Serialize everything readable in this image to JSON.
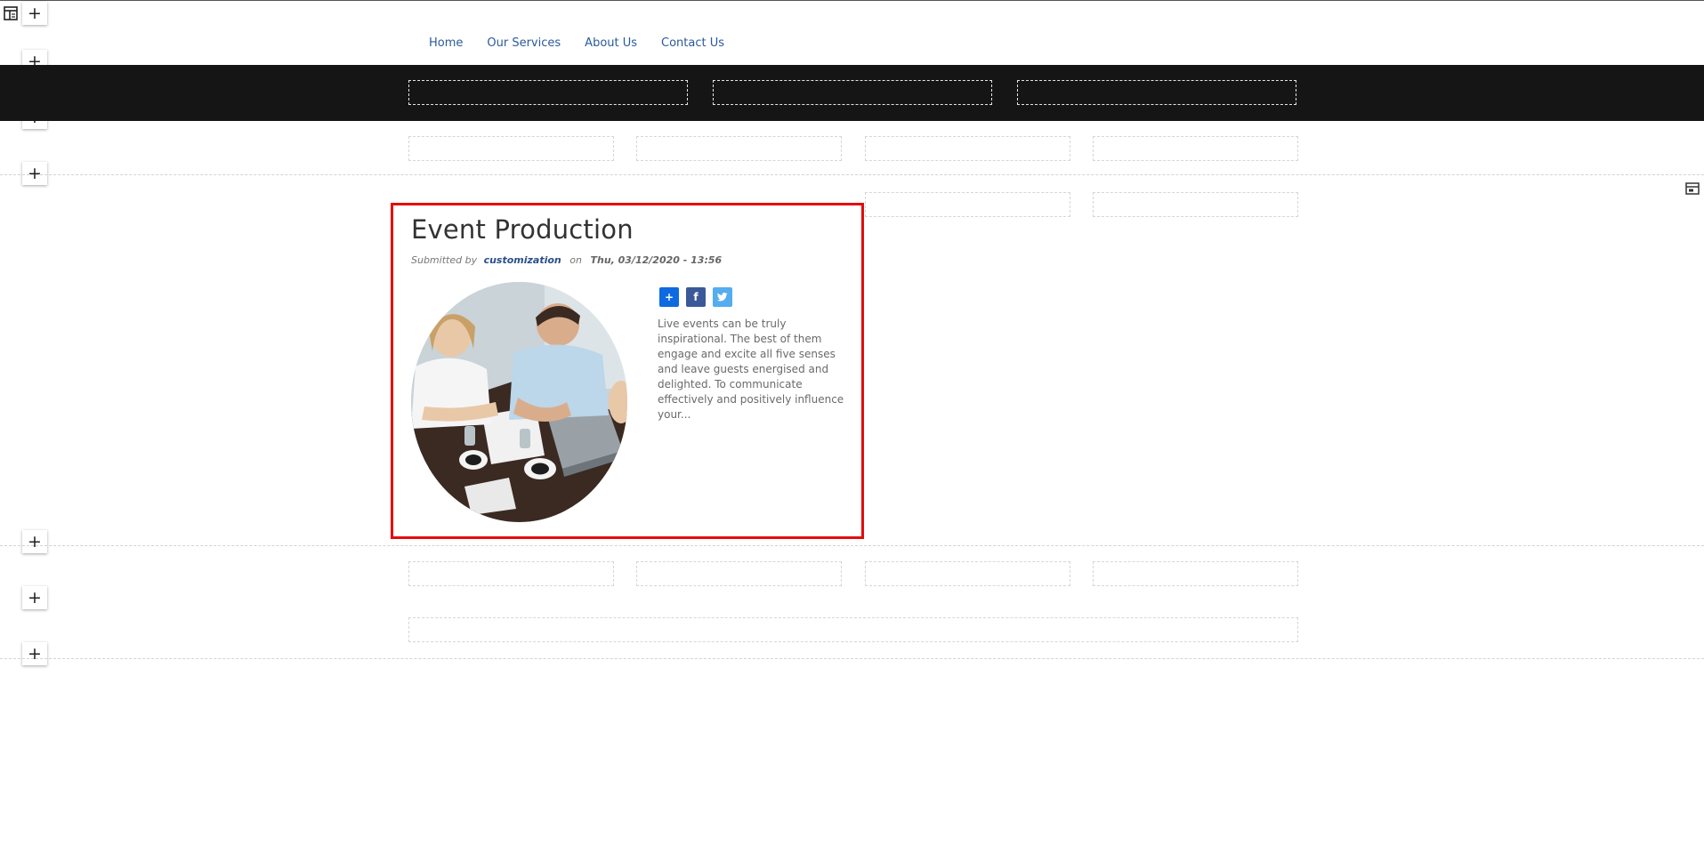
{
  "builder": {
    "add_label": "+",
    "layout_icon": "layout-template-icon",
    "settings_icon": "block-settings-icon"
  },
  "nav": {
    "items": [
      {
        "label": "Home"
      },
      {
        "label": "Our Services"
      },
      {
        "label": "About Us"
      },
      {
        "label": "Contact Us"
      }
    ]
  },
  "article": {
    "title": "Event Production",
    "submitted_by": "Submitted by",
    "author": "customization",
    "on": "on",
    "date": "Thu, 03/12/2020 - 13:56",
    "summary": "Live events can be truly inspirational. The best of them engage and excite all five senses and leave guests energised and delighted. To communicate effectively and positively influence your...",
    "share": [
      {
        "icon": "share-plus-icon",
        "glyph": "+",
        "color": "#0d6ae0"
      },
      {
        "icon": "facebook-icon",
        "glyph": "f",
        "color": "#3b5998"
      },
      {
        "icon": "twitter-icon",
        "glyph": "t",
        "color": "#55acee"
      }
    ]
  },
  "colors": {
    "accent_border": "#e40c0c",
    "nav_link": "#2a5a9c",
    "header_band": "#151515"
  }
}
